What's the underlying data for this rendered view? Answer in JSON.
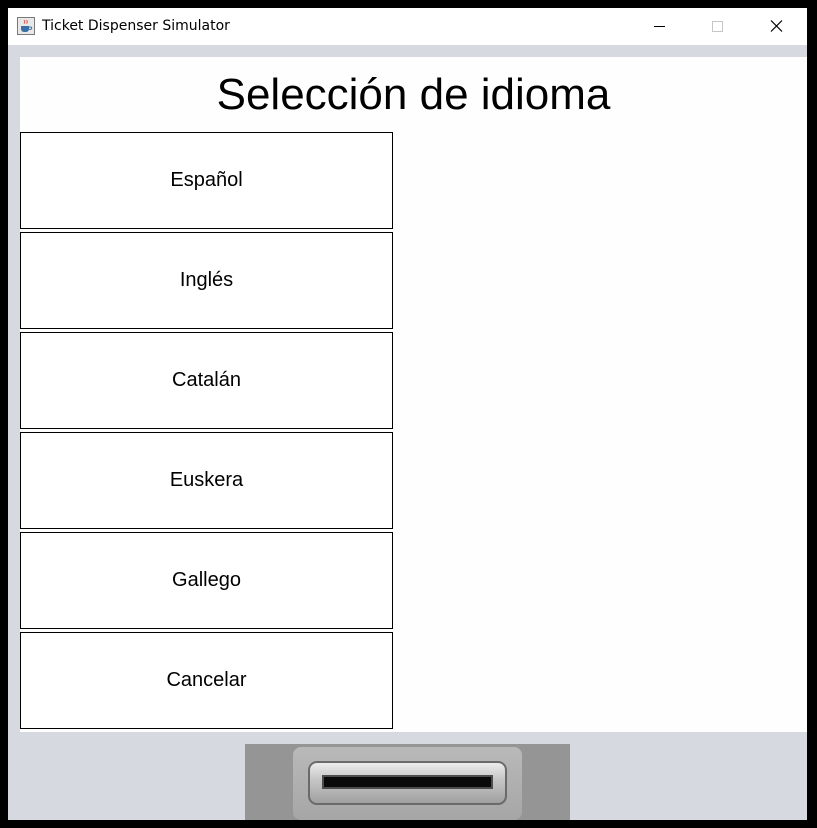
{
  "window": {
    "title": "Ticket Dispenser Simulator",
    "icon": "java-cup-icon",
    "controls": [
      "minimize-icon",
      "maximize-icon",
      "close-icon"
    ]
  },
  "screen": {
    "heading": "Selección de idioma",
    "options": [
      {
        "label": "Español"
      },
      {
        "label": "Inglés"
      },
      {
        "label": "Catalán"
      },
      {
        "label": "Euskera"
      },
      {
        "label": "Gallego"
      },
      {
        "label": "Cancelar"
      }
    ]
  },
  "dispenser": {
    "slot": "ticket-slot-icon"
  }
}
